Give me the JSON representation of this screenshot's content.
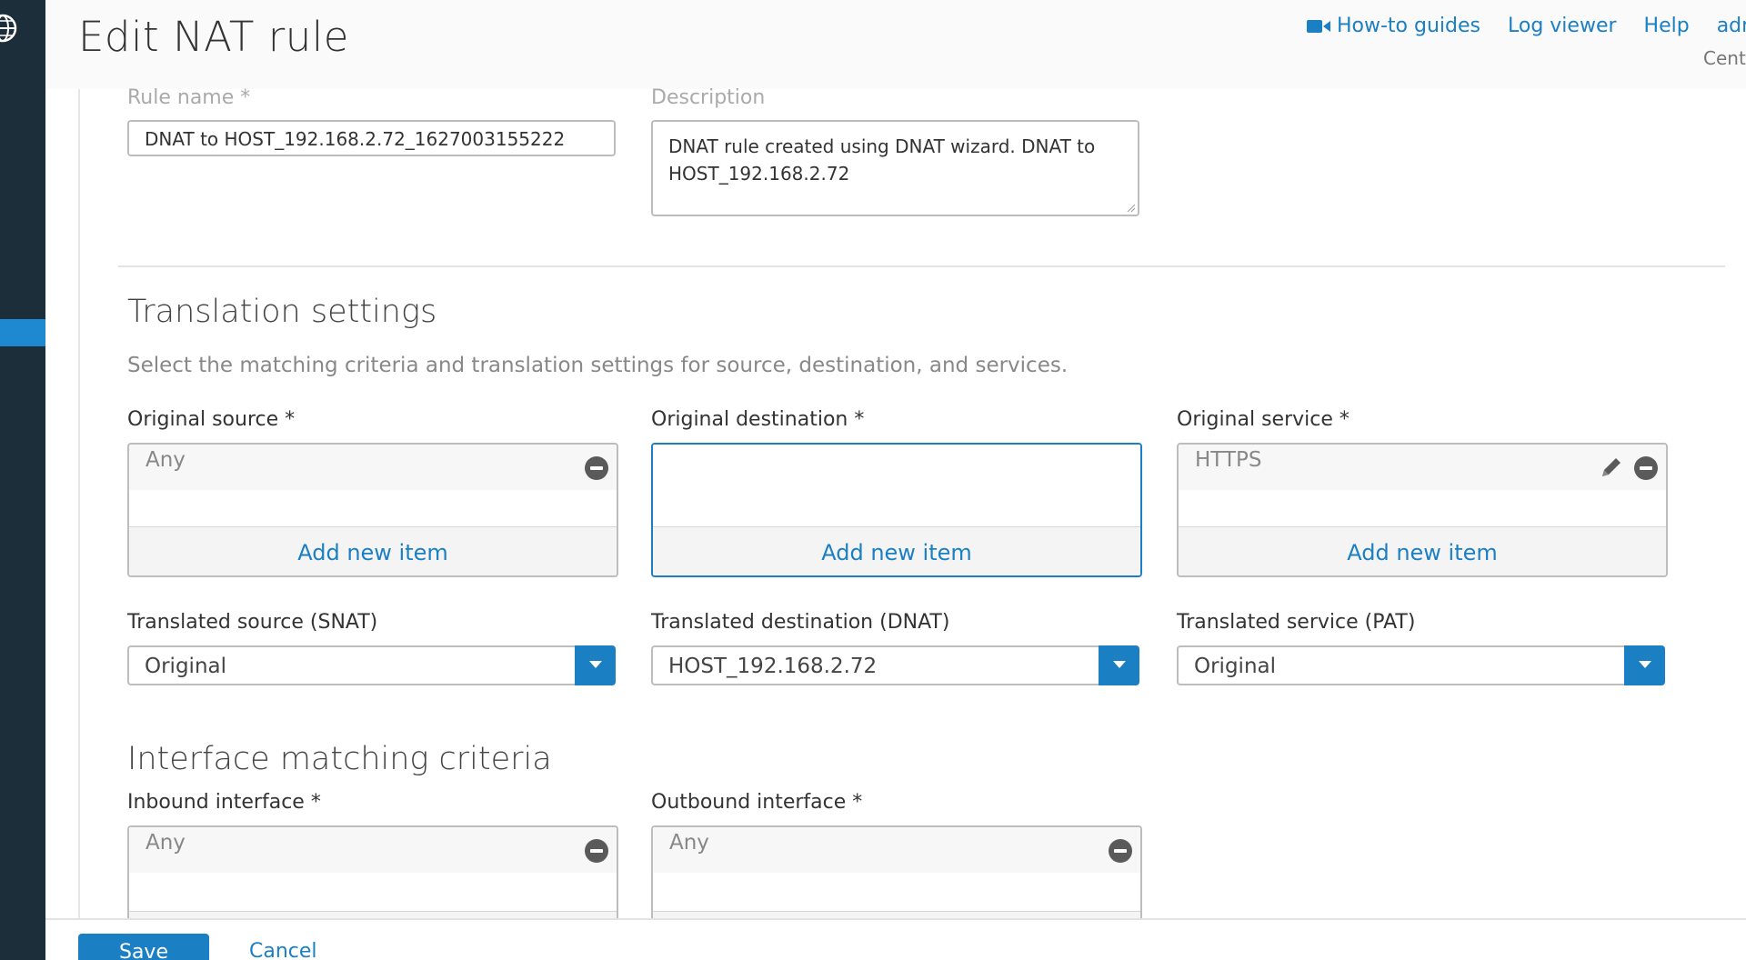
{
  "header": {
    "title": "Edit NAT rule",
    "links": {
      "howto": "How-to guides",
      "logviewer": "Log viewer",
      "help": "Help",
      "admin": "adm"
    },
    "sub": "Cent"
  },
  "general": {
    "rule_name_label": "Rule name *",
    "rule_name_value": "DNAT to HOST_192.168.2.72_1627003155222",
    "description_label": "Description",
    "description_line1": "DNAT rule created using DNAT wizard. DNAT to",
    "description_line2": "HOST_192.168.2.72"
  },
  "translation": {
    "title": "Translation settings",
    "description": "Select the matching criteria and translation settings for source, destination, and services.",
    "original_source": {
      "label": "Original source *",
      "item": "Any",
      "add": "Add new item"
    },
    "original_destination": {
      "label": "Original destination *",
      "item": "",
      "add": "Add new item"
    },
    "original_service": {
      "label": "Original service *",
      "item": "HTTPS",
      "add": "Add new item"
    },
    "translated_source": {
      "label": "Translated source (SNAT)",
      "value": "Original"
    },
    "translated_destination": {
      "label": "Translated destination (DNAT)",
      "value": "HOST_192.168.2.72"
    },
    "translated_service": {
      "label": "Translated service (PAT)",
      "value": "Original"
    }
  },
  "interface": {
    "title": "Interface matching criteria",
    "inbound": {
      "label": "Inbound interface *",
      "item": "Any"
    },
    "outbound": {
      "label": "Outbound interface *",
      "item": "Any"
    }
  },
  "footer": {
    "save": "Save",
    "cancel": "Cancel"
  },
  "colors": {
    "accent": "#1b7fc4",
    "sidebar": "#1d2e3b",
    "sidebar_active": "#1e88d0"
  },
  "icons": {
    "globe": "globe-icon",
    "camera": "video-camera-icon",
    "remove": "minus-circle-icon",
    "edit": "pencil-icon",
    "dropdown": "chevron-down-icon"
  }
}
